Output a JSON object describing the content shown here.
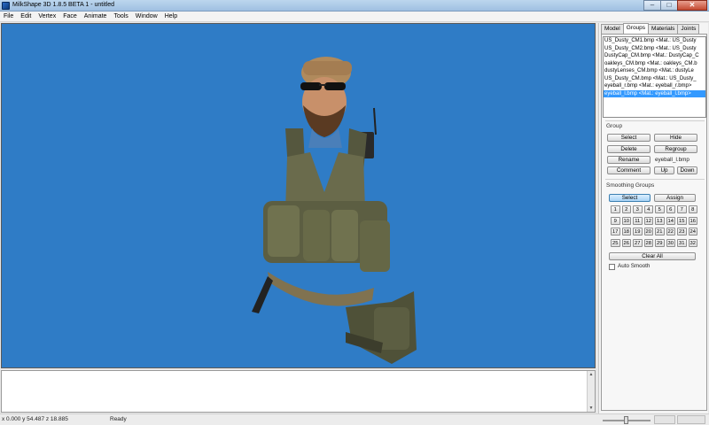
{
  "window": {
    "title": "MilkShape 3D 1.8.5 BETA 1 - untitled",
    "controls": {
      "minimize": "–",
      "maximize": "□",
      "close": "✕"
    }
  },
  "menu": [
    "File",
    "Edit",
    "Vertex",
    "Face",
    "Animate",
    "Tools",
    "Window",
    "Help"
  ],
  "viewport": {
    "background": "#2f7cc6"
  },
  "panel": {
    "tabs": [
      "Model",
      "Groups",
      "Materials",
      "Joints"
    ],
    "active_tab": "Groups",
    "groups": [
      "US_Dusty_CM1.bmp <Mat.: US_Dusty",
      "US_Dusty_CM2.bmp <Mat.: US_Dusty",
      "DustyCap_CM.bmp <Mat.: DustyCap_C",
      "oakleys_CM.bmp <Mat.: oakleys_CM.b",
      "dustyLenses_CM.bmp <Mat.: dustyLe",
      "US_Dusty_CM.bmp <Mat.: US_Dusty_",
      "eyeball_r.bmp <Mat.: eyeball_r.bmp>",
      "eyeball_l.bmp <Mat.: eyeball_l.bmp>"
    ],
    "selected_group_index": 7,
    "group_section": {
      "label": "Group",
      "select": "Select",
      "hide": "Hide",
      "delete": "Delete",
      "regroup": "Regroup",
      "rename": "Rename",
      "name_value": "eyeball_l.bmp",
      "comment": "Comment",
      "up": "Up",
      "down": "Down"
    },
    "smoothing": {
      "label": "Smoothing Groups",
      "select": "Select",
      "assign": "Assign",
      "numbers": [
        "1",
        "2",
        "3",
        "4",
        "5",
        "6",
        "7",
        "8",
        "9",
        "10",
        "11",
        "12",
        "13",
        "14",
        "15",
        "16",
        "17",
        "18",
        "19",
        "20",
        "21",
        "22",
        "23",
        "24",
        "25",
        "26",
        "27",
        "28",
        "29",
        "30",
        "31",
        "32"
      ],
      "clear_all": "Clear All",
      "auto_smooth": "Auto Smooth",
      "auto_smooth_checked": false
    }
  },
  "status": {
    "coords": "x 0.000 y 54.487 z 18.885",
    "text": "Ready"
  }
}
